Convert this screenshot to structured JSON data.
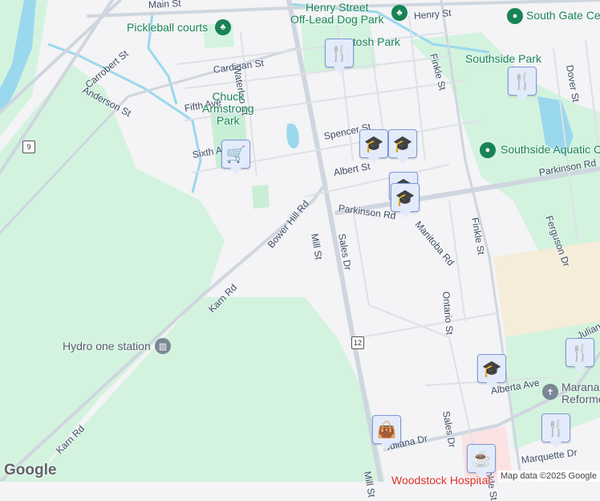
{
  "streets": {
    "main": "Main St",
    "henry": "Henry St",
    "cardigan": "Cardigan St",
    "waterloo": "Waterloo St",
    "carrobert": "Carrobert St",
    "anderson": "Anderson St",
    "fifth": "Fifth Ave",
    "sixth": "Sixth Ave",
    "spencer": "Spencer St",
    "albert": "Albert St",
    "parkinson1": "Parkinson Rd",
    "parkinson2": "Parkinson Rd",
    "bower": "Bower Hill Rd",
    "mill1": "Mill St",
    "mill2": "Mill St",
    "sales1": "Sales Dr",
    "sales2": "Sales Dr",
    "manitoba": "Manitoba Rd",
    "ontario": "Ontario St",
    "finkle1": "Finkle St",
    "finkle2": "Finkle St",
    "finkle3": "Finkle St",
    "ferguson": "Ferguson Dr",
    "dover": "Dover St",
    "karn1": "Karn Rd",
    "karn2": "Karn Rd",
    "alberta": "Alberta Ave",
    "juliana": "Juliana Dr",
    "juliana2": "Juliana",
    "marquette": "Marquette Dr"
  },
  "places": {
    "dog_park": "Henry Street\nOff-Lead Dog Park",
    "pickleball": "Pickleball courts",
    "mcintosh": "ntosh Park",
    "south_gate": "South Gate Cen",
    "southside_park": "Southside Park",
    "chuck": "Chuck\nArmstrong\nPark",
    "aquatic": "Southside Aquatic C",
    "hydro": "Hydro one station",
    "maranatha": "Maranatha\nReforme",
    "hospital": "Woodstock Hospital"
  },
  "highways": {
    "h9": "9",
    "h12": "12"
  },
  "icons": {
    "restaurant": "fork-knife-icon",
    "school": "graduation-cap-icon",
    "shopping": "shopping-bag-icon",
    "cafe": "coffee-cup-icon",
    "grocery": "shopping-cart-icon",
    "church": "cross-icon",
    "park": "tree-icon"
  },
  "attribution": "Map data ©2025 Google",
  "logo": "Google",
  "colors": {
    "background": "#f4f3f5",
    "green": "#d3f3df",
    "water": "#9ad8ee",
    "road": "#cfd6df",
    "label": "#3b4a63",
    "park_label": "#188356"
  }
}
